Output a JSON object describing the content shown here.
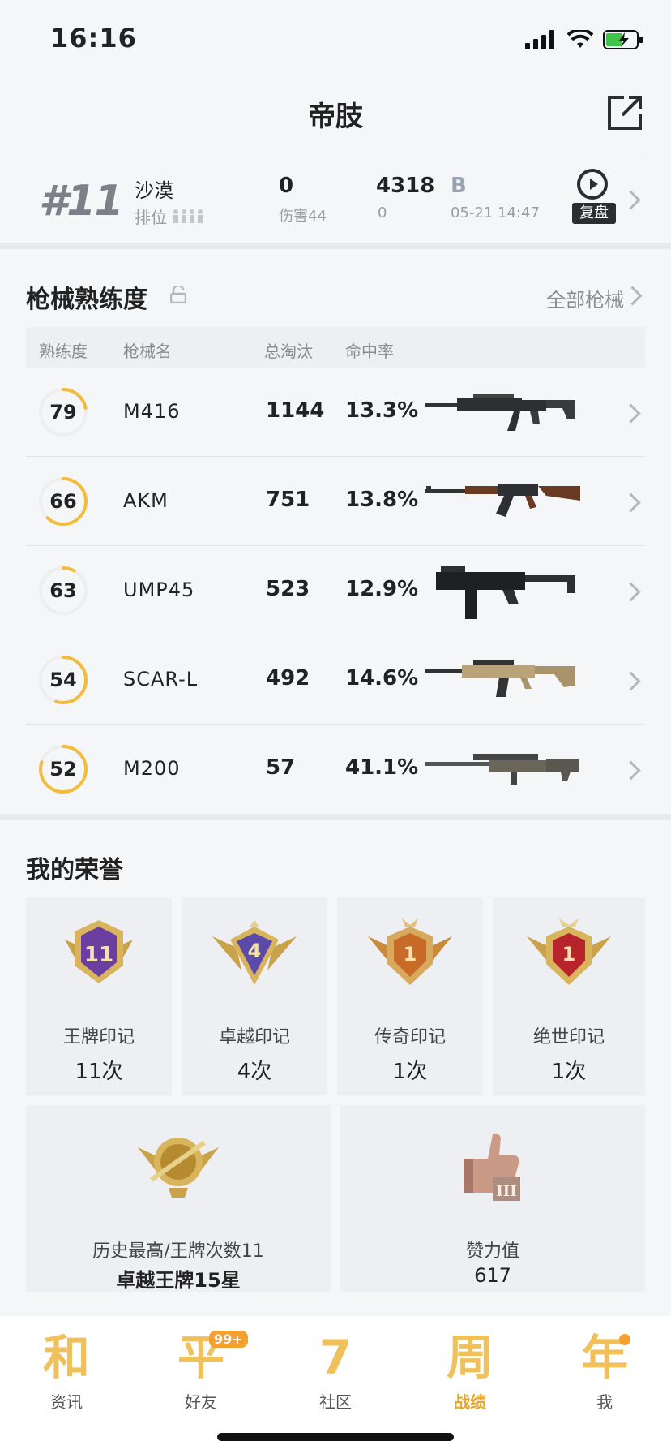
{
  "status": {
    "time": "16:16"
  },
  "header": {
    "title": "帝肢"
  },
  "match": {
    "rank": "#11",
    "mode": "沙漠",
    "rank_label": "排位",
    "kills": "0",
    "damage": "伤害44",
    "score": "4318",
    "score_sub": "0",
    "grade": "B",
    "datetime": "05-21 14:47",
    "replay_label": "复盘"
  },
  "weapons": {
    "title": "枪械熟练度",
    "all_link": "全部枪械",
    "headers": {
      "mastery": "熟练度",
      "name": "枪械名",
      "kills": "总淘汰",
      "accuracy": "命中率"
    },
    "rows": [
      {
        "mastery": "79",
        "mastery_fraction": 0.22,
        "name": "M416",
        "kills": "1144",
        "accuracy": "13.3%"
      },
      {
        "mastery": "66",
        "mastery_fraction": 0.62,
        "name": "AKM",
        "kills": "751",
        "accuracy": "13.8%"
      },
      {
        "mastery": "63",
        "mastery_fraction": 0.08,
        "name": "UMP45",
        "kills": "523",
        "accuracy": "12.9%"
      },
      {
        "mastery": "54",
        "mastery_fraction": 0.55,
        "name": "SCAR-L",
        "kills": "492",
        "accuracy": "14.6%"
      },
      {
        "mastery": "52",
        "mastery_fraction": 0.8,
        "name": "M200",
        "kills": "57",
        "accuracy": "41.1%"
      }
    ]
  },
  "honors": {
    "title": "我的荣誉",
    "badges": [
      {
        "label": "王牌印记",
        "count": "11次",
        "number": "11",
        "color": "#6a3fa0"
      },
      {
        "label": "卓越印记",
        "count": "4次",
        "number": "4",
        "color": "#5b4aa8"
      },
      {
        "label": "传奇印记",
        "count": "1次",
        "number": "1",
        "color": "#c86a28"
      },
      {
        "label": "绝世印记",
        "count": "1次",
        "number": "1",
        "color": "#b8242c"
      }
    ],
    "highest": {
      "label": "历史最高/王牌次数11",
      "value": "卓越王牌15星"
    },
    "likes": {
      "label": "赞力值",
      "value": "617"
    }
  },
  "tabs": [
    {
      "glyph": "和",
      "label": "资讯"
    },
    {
      "glyph": "平",
      "label": "好友",
      "badge": "99+"
    },
    {
      "glyph": "7",
      "label": "社区"
    },
    {
      "glyph": "周",
      "label": "战绩",
      "active": true
    },
    {
      "glyph": "年",
      "label": "我"
    }
  ],
  "colors": {
    "accent": "#f0c15a",
    "ring_track": "#eeeeee",
    "ring_fill": "#f2bd3c"
  }
}
